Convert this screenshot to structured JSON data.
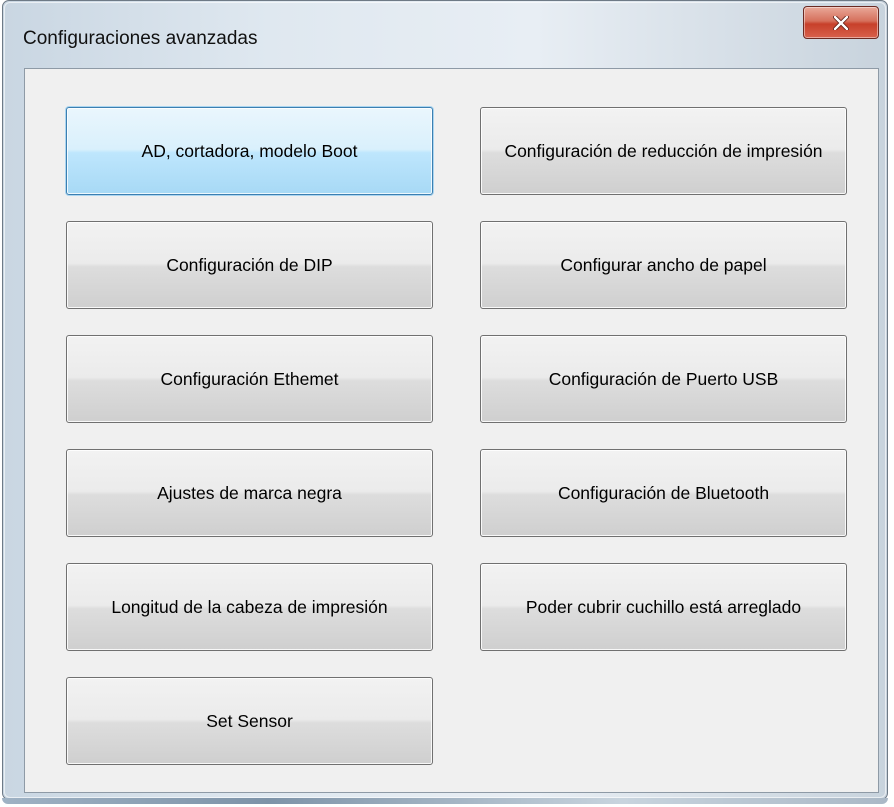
{
  "window": {
    "title": "Configuraciones avanzadas",
    "close_label": "×"
  },
  "buttons": {
    "ad_cutter_boot": "AD, cortadora, modelo Boot",
    "print_reduction": "Configuración de reducción de impresión",
    "dip": "Configuración de DIP",
    "paper_width": "Configurar ancho de papel",
    "ethernet": "Configuración Ethemet",
    "usb_port": "Configuración de Puerto USB",
    "black_mark": "Ajustes de marca negra",
    "bluetooth": "Configuración de Bluetooth",
    "print_head_length": "Longitud de la cabeza de impresión",
    "knife_cover": "Poder cubrir cuchillo está arreglado",
    "set_sensor": "Set Sensor"
  },
  "colors": {
    "close_button": "#c7402a",
    "focus_border": "#3c7fb1",
    "client_background": "#f0f0f0"
  },
  "icons": {
    "close": "close-icon"
  }
}
